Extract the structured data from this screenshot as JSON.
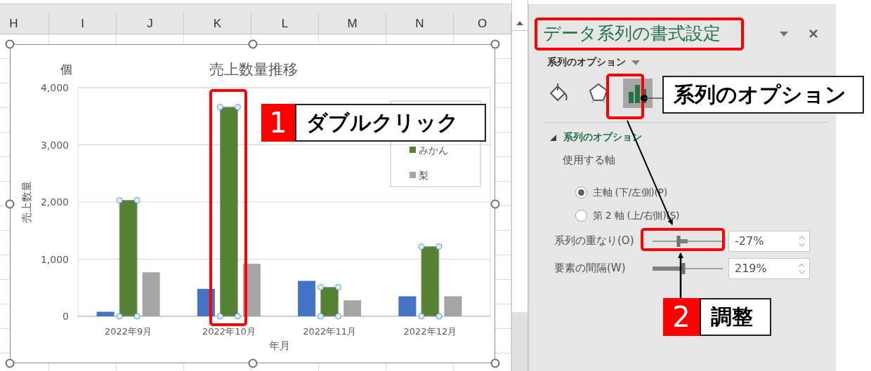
{
  "sheet": {
    "columns": [
      "H",
      "I",
      "J",
      "K",
      "L",
      "M",
      "N",
      "O"
    ],
    "chart": {
      "unit_label": "個",
      "chart_data": {
        "type": "bar",
        "title": "売上数量推移",
        "xlabel": "年月",
        "ylabel": "売上数量",
        "categories": [
          "2022年9月",
          "2022年10月",
          "2022年11月",
          "2022年12月"
        ],
        "series": [
          {
            "color": "#4472c4",
            "values": [
              80,
              480,
              620,
              350
            ]
          },
          {
            "name": "みかん",
            "color": "#548235",
            "values": [
              2030,
              3660,
              510,
              1220
            ]
          },
          {
            "name": "梨",
            "color": "#a5a5a5",
            "values": [
              770,
              920,
              280,
              350
            ]
          }
        ],
        "grid": true,
        "legend": true,
        "ylim": [
          0,
          4000
        ],
        "yticks": [
          {
            "value": 0,
            "label": "0"
          },
          {
            "value": 1000,
            "label": "1,000"
          },
          {
            "value": 2000,
            "label": "2,000"
          },
          {
            "value": 3000,
            "label": "3,000"
          },
          {
            "value": 4000,
            "label": "4,000"
          }
        ]
      },
      "series_states": [
        {
          "selected": false
        },
        {
          "selected": true
        },
        {
          "selected": false
        }
      ]
    }
  },
  "pane": {
    "title": "データ系列の書式設定",
    "section_menu": "系列のオプション",
    "icon_tabs": [
      {
        "kind": "fill",
        "selected": false
      },
      {
        "kind": "shape",
        "selected": false
      },
      {
        "kind": "options",
        "selected": true
      }
    ],
    "section": {
      "title": "系列のオプション",
      "expanded": true,
      "axis_label": "使用する軸",
      "axis_options": [
        {
          "label": "主軸 (下/左側)(P)",
          "selected": true
        },
        {
          "label": "第 2 軸 (上/右側)(S)",
          "selected": false
        }
      ],
      "sliders": [
        {
          "label": "系列の重なり(O)",
          "kind": "bipolar",
          "level": 0.365,
          "value": "-27%"
        },
        {
          "label": "要素の間隔(W)",
          "kind": "unipolar",
          "level": 0.438,
          "value": "219%"
        }
      ]
    }
  },
  "annotations": [
    {
      "number": "1",
      "text": "ダブルクリック"
    },
    {
      "number": "2",
      "text": "調整"
    }
  ],
  "callout": {
    "text": "系列のオプション"
  }
}
